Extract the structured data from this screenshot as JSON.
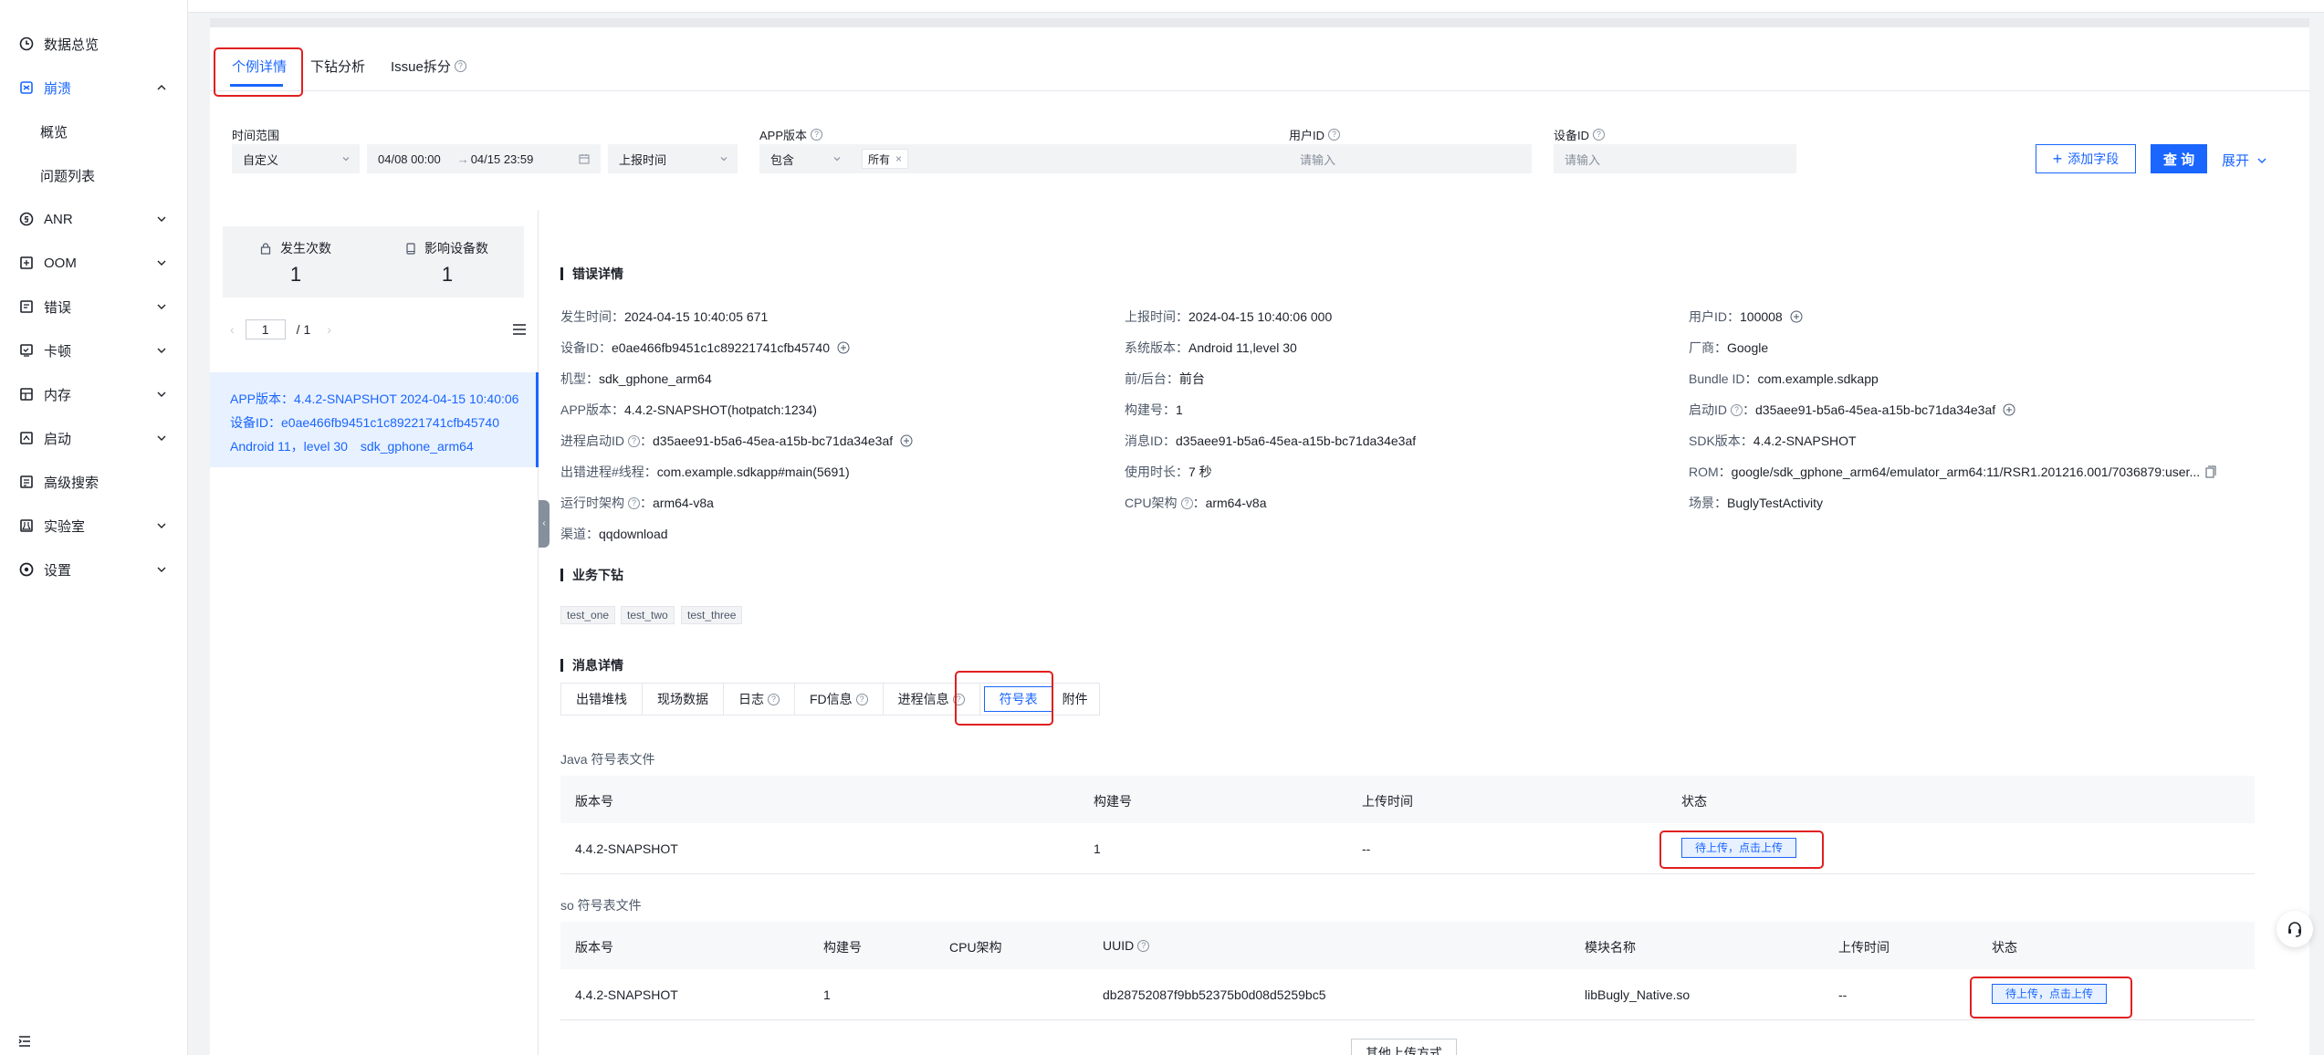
{
  "sidebar": {
    "items": [
      {
        "label": "数据总览",
        "icon": "clock-icon"
      },
      {
        "label": "崩溃",
        "icon": "crash-icon"
      },
      {
        "label": "概览"
      },
      {
        "label": "问题列表"
      },
      {
        "label": "ANR",
        "icon": "anr-icon"
      },
      {
        "label": "OOM",
        "icon": "oom-icon"
      },
      {
        "label": "错误",
        "icon": "error-icon"
      },
      {
        "label": "卡顿",
        "icon": "lag-icon"
      },
      {
        "label": "内存",
        "icon": "memory-icon"
      },
      {
        "label": "启动",
        "icon": "launch-icon"
      },
      {
        "label": "高级搜索",
        "icon": "advanced-search-icon"
      },
      {
        "label": "实验室",
        "icon": "lab-icon"
      },
      {
        "label": "设置",
        "icon": "settings-icon"
      }
    ]
  },
  "tabs": {
    "detail": "个例详情",
    "drill": "下钻分析",
    "issue": "Issue拆分"
  },
  "filters": {
    "time_range_label": "时间范围",
    "time_range_value": "自定义",
    "start": "04/08 00:00",
    "sep": "→",
    "end": "04/15 23:59",
    "time_type": "上报时间",
    "app_version_label": "APP版本",
    "app_version_op": "包含",
    "app_version_tag": "所有",
    "user_id_label": "用户ID",
    "user_id_placeholder": "请输入",
    "device_id_label": "设备ID",
    "device_id_placeholder": "请输入",
    "add_field": "添加字段",
    "query": "查 询",
    "expand": "展开"
  },
  "stats": {
    "occurrences_label": "发生次数",
    "occurrences": "1",
    "devices_label": "影响设备数",
    "devices": "1"
  },
  "pager": {
    "page": "1",
    "total": "/ 1"
  },
  "case": {
    "line1": "APP版本：4.4.2-SNAPSHOT 2024-04-15 10:40:06",
    "line2": "设备ID：e0ae466fb9451c1c89221741cfb45740",
    "line3": "Android 11，level 30　sdk_gphone_arm64"
  },
  "sections": {
    "error_detail": "错误详情",
    "business": "业务下钻",
    "message": "消息详情"
  },
  "info": {
    "occur_time_k": "发生时间：",
    "occur_time": "2024-04-15 10:40:05 671",
    "report_time_k": "上报时间：",
    "report_time": "2024-04-15 10:40:06 000",
    "user_id_k": "用户ID：",
    "user_id": "100008",
    "device_id_k": "设备ID：",
    "device_id": "e0ae466fb9451c1c89221741cfb45740",
    "os_k": "系统版本：",
    "os": "Android 11,level 30",
    "vendor_k": "厂商：",
    "vendor": "Google",
    "model_k": "机型：",
    "model": "sdk_gphone_arm64",
    "fg_k": "前/后台：",
    "fg": "前台",
    "bundle_k": "Bundle ID：",
    "bundle": "com.example.sdkapp",
    "appver_k": "APP版本：",
    "appver": "4.4.2-SNAPSHOT(hotpatch:1234)",
    "build_k": "构建号：",
    "build": "1",
    "launch_id_k": "启动ID",
    "launch_id": "d35aee91-b5a6-45ea-a15b-bc71da34e3af",
    "proc_launch_k": "进程启动ID",
    "proc_launch": "d35aee91-b5a6-45ea-a15b-bc71da34e3af",
    "msg_id_k": "消息ID：",
    "msg_id": "d35aee91-b5a6-45ea-a15b-bc71da34e3af",
    "sdk_k": "SDK版本：",
    "sdk": "4.4.2-SNAPSHOT",
    "thread_k": "出错进程#线程：",
    "thread": "com.example.sdkapp#main(5691)",
    "duration_k": "使用时长：",
    "duration": "7 秒",
    "rom_k": "ROM：",
    "rom": "google/sdk_gphone_arm64/emulator_arm64:11/RSR1.201216.001/7036879:user...",
    "runtime_arch_k": "运行时架构",
    "runtime_arch": "arm64-v8a",
    "cpu_arch_k": "CPU架构",
    "cpu_arch": "arm64-v8a",
    "scene_k": "场景：",
    "scene": "BuglyTestActivity",
    "channel_k": "渠道：",
    "channel": "qqdownload"
  },
  "business_tags": [
    "test_one",
    "test_two",
    "test_three"
  ],
  "msg_tabs": [
    "出错堆栈",
    "现场数据",
    "日志",
    "FD信息",
    "进程信息",
    "符号表",
    "附件"
  ],
  "java_table": {
    "caption": "Java 符号表文件",
    "headers": [
      "版本号",
      "构建号",
      "上传时间",
      "状态"
    ],
    "row": {
      "version": "4.4.2-SNAPSHOT",
      "build": "1",
      "time": "--",
      "status": "待上传，点击上传"
    }
  },
  "so_table": {
    "caption": "so 符号表文件",
    "headers": [
      "版本号",
      "构建号",
      "CPU架构",
      "UUID",
      "模块名称",
      "上传时间",
      "状态"
    ],
    "row": {
      "version": "4.4.2-SNAPSHOT",
      "build": "1",
      "cpu": "",
      "uuid": "db28752087f9bb52375b0d08d5259bc5",
      "module": "libBugly_Native.so",
      "time": "--",
      "status": "待上传，点击上传"
    }
  },
  "other_upload": "其他上传方式",
  "colors": {
    "accent": "#1a66ff",
    "highlight": "#e02020"
  }
}
